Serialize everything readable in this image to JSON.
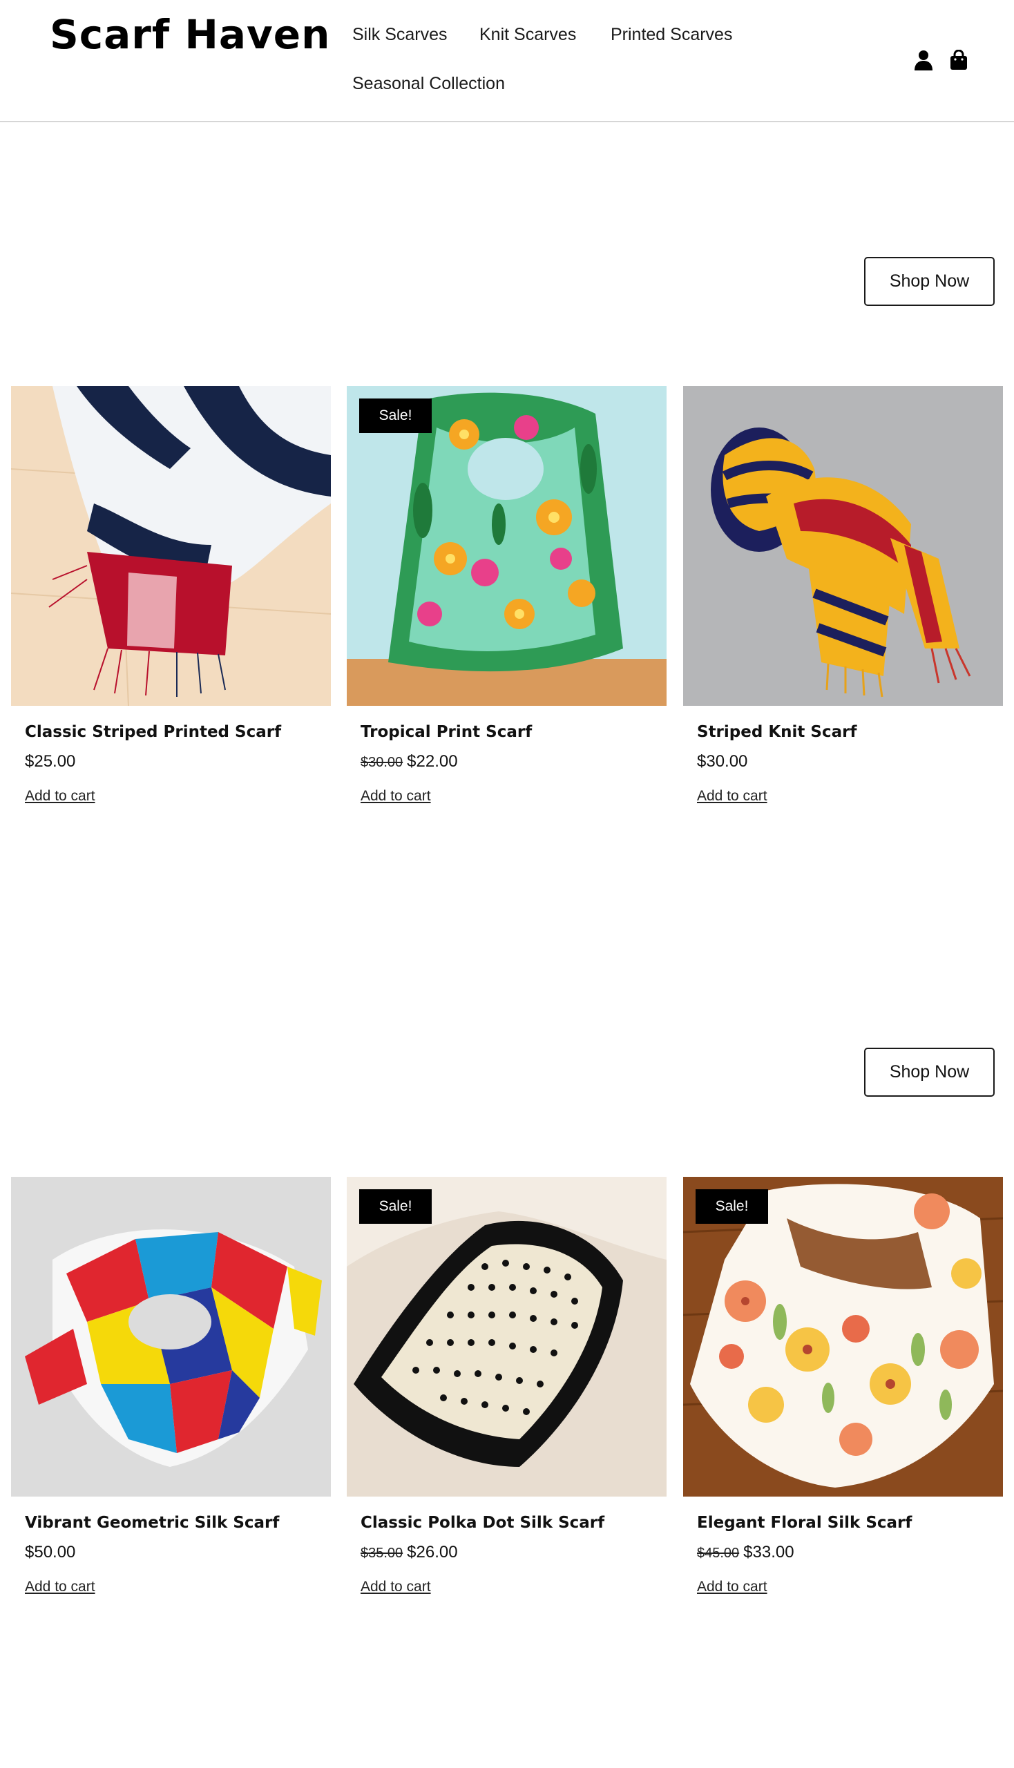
{
  "header": {
    "logo": "Scarf Haven",
    "nav": [
      "Silk Scarves",
      "Knit Scarves",
      "Printed Scarves",
      "Seasonal Collection"
    ],
    "icons": [
      "user-icon",
      "shopping-bag-icon"
    ]
  },
  "sections": [
    {
      "shop_now": "Shop Now",
      "products": [
        {
          "title": "Classic Striped Printed Scarf",
          "price": "$25.00",
          "old_price": "",
          "badge": "",
          "cart": "Add to cart"
        },
        {
          "title": "Tropical Print Scarf",
          "price": "$22.00",
          "old_price": "$30.00",
          "badge": "Sale!",
          "cart": "Add to cart"
        },
        {
          "title": "Striped Knit Scarf",
          "price": "$30.00",
          "old_price": "",
          "badge": "",
          "cart": "Add to cart"
        }
      ]
    },
    {
      "shop_now": "Shop Now",
      "products": [
        {
          "title": "Vibrant Geometric Silk Scarf",
          "price": "$50.00",
          "old_price": "",
          "badge": "",
          "cart": "Add to cart"
        },
        {
          "title": "Classic Polka Dot Silk Scarf",
          "price": "$26.00",
          "old_price": "$35.00",
          "badge": "Sale!",
          "cart": "Add to cart"
        },
        {
          "title": "Elegant Floral Silk Scarf",
          "price": "$33.00",
          "old_price": "$45.00",
          "badge": "Sale!",
          "cart": "Add to cart"
        }
      ]
    }
  ],
  "colors": {
    "badge_bg": "#000000",
    "text": "#111111",
    "divider": "#d6d6d6"
  }
}
